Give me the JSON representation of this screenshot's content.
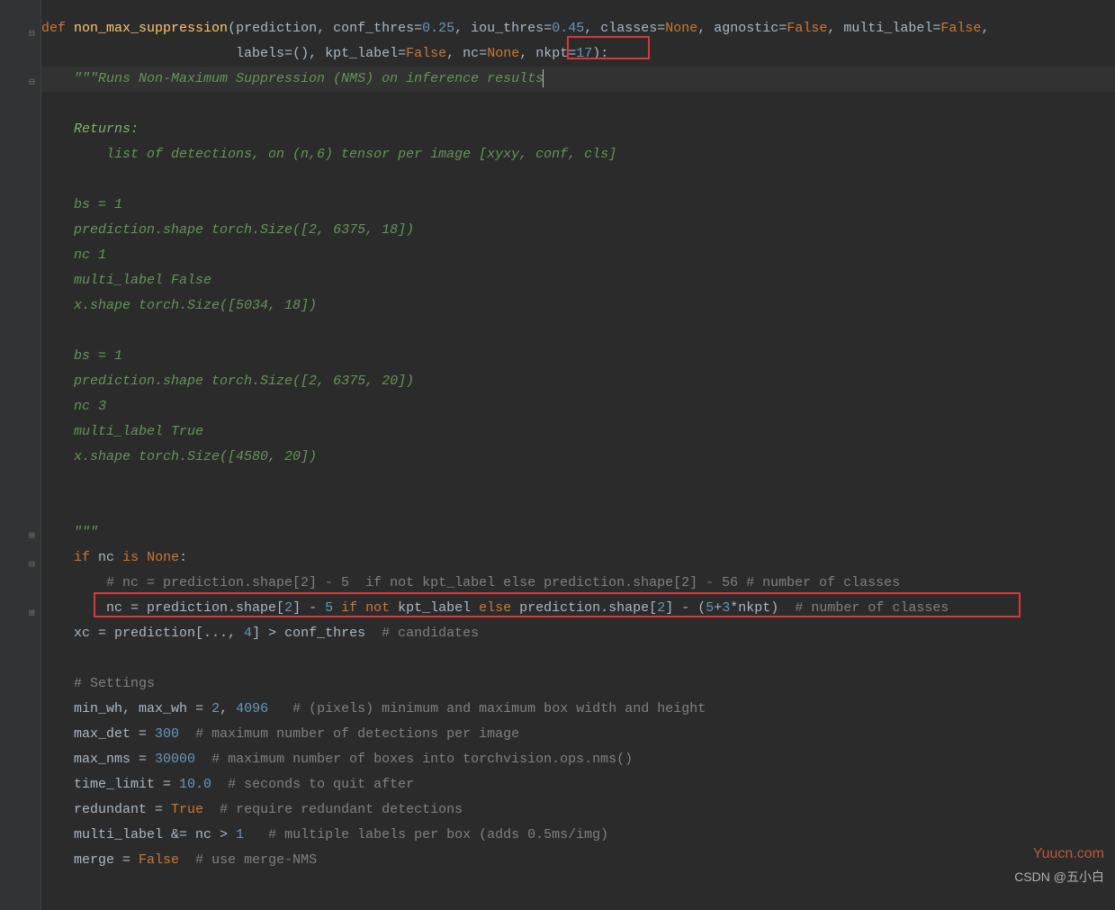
{
  "code": {
    "def": "def",
    "fn_name": "non_max_suppression",
    "params": {
      "prediction": "prediction",
      "conf_thres": "conf_thres",
      "conf_thres_val": "0.25",
      "iou_thres": "iou_thres",
      "iou_thres_val": "0.45",
      "classes": "classes",
      "classes_val": "None",
      "agnostic": "agnostic",
      "agnostic_val": "False",
      "multi_label": "multi_label",
      "multi_label_val": "False",
      "labels": "labels",
      "labels_val": "()",
      "kpt_label": "kpt_label",
      "kpt_label_val": "False",
      "nc": "nc",
      "nc_val": "None",
      "nkpt": "nkpt",
      "nkpt_val": "17"
    },
    "doc": {
      "open": "\"\"\"Runs Non-Maximum Suppression (NMS) on inference results",
      "returns_label": "Returns:",
      "returns_desc": "list of detections, on (n,6) tensor per image [xyxy, conf, cls]",
      "bs1_a": "bs = 1",
      "pred_shape_a": "prediction.shape torch.Size([2, 6375, 18])",
      "nc1": "nc 1",
      "ml_false": "multi_label False",
      "xshape_a": "x.shape torch.Size([5034, 18])",
      "bs1_b": "bs = 1",
      "pred_shape_b": "prediction.shape torch.Size([2, 6375, 20])",
      "nc3": "nc 3",
      "ml_true": "multi_label True",
      "xshape_b": "x.shape torch.Size([4580, 20])",
      "close": "\"\"\""
    },
    "body": {
      "if": "if",
      "nc": "nc",
      "is": "is",
      "none_kw": "None",
      "colon": ":",
      "comment_nc": "# nc = prediction.shape[2] - 5  if not kpt_label else prediction.shape[2] - 56 # number of classes",
      "nc_assign_lhs": "nc = prediction.shape[",
      "two_a": "2",
      "bracket_minus5": "] - ",
      "five": "5",
      "if_inline": " if not ",
      "kpt": "kpt_label",
      "else": " else ",
      "pred_shape2": "prediction.shape[",
      "two_b": "2",
      "close_bracket": "] - (",
      "five_b": "5",
      "plus": "+",
      "three": "3",
      "star": "*",
      "nkpt_var": "nkpt",
      "paren_close": ") ",
      "comment_noc": " # number of classes",
      "xc_line_pre": "xc = prediction[..., ",
      "four": "4",
      "xc_gt": "] > conf_thres  ",
      "xc_comment": "# candidates",
      "settings_comment": "# Settings",
      "min_wh": "min_wh",
      "max_wh": "max_wh",
      "two_c": "2",
      "v4096": "4096",
      "minmax_comment": "# (pixels) minimum and maximum box width and height",
      "max_det": "max_det = ",
      "v300": "300",
      "max_det_comment": "# maximum number of detections per image",
      "max_nms": "max_nms = ",
      "v30000": "30000",
      "max_nms_comment": "# maximum number of boxes into torchvision.ops.nms()",
      "time_limit": "time_limit = ",
      "v10": "10.0",
      "time_comment": "# seconds to quit after",
      "redundant": "redundant = ",
      "true": "True",
      "redundant_comment": "# require redundant detections",
      "ml_line": "multi_label &= nc > ",
      "one": "1",
      "ml_comment": "# multiple labels per box (adds 0.5ms/img)",
      "merge": "merge = ",
      "false": "False",
      "merge_comment": "# use merge-NMS"
    }
  },
  "watermark": {
    "w1": "Yuucn.com",
    "w2": "CSDN @五小白"
  }
}
